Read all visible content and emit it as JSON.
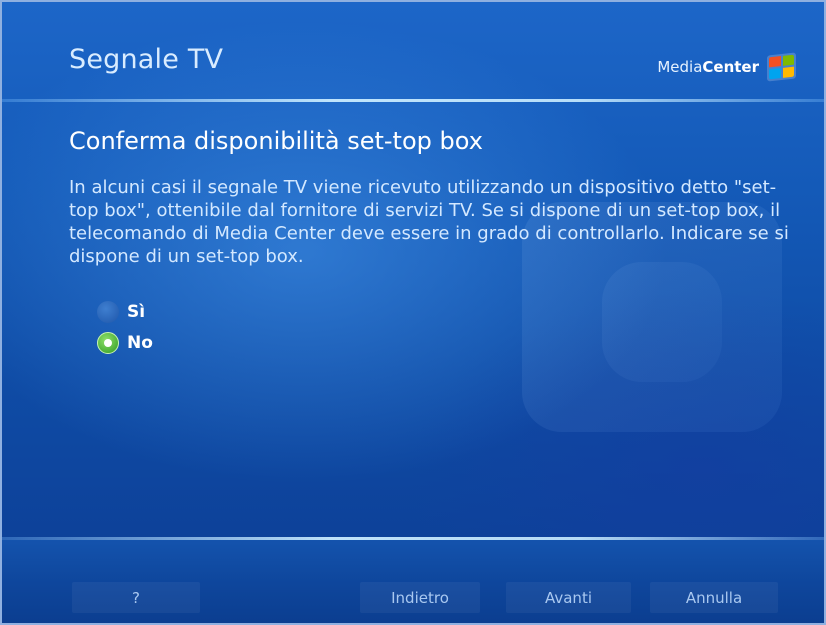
{
  "header": {
    "title": "Segnale TV"
  },
  "logo": {
    "prefix": "Media",
    "suffix": "Center",
    "icon": "windows-flag-icon"
  },
  "main": {
    "section_title": "Conferma disponibilità set-top box",
    "description": "In alcuni casi il segnale TV viene ricevuto utilizzando un dispositivo detto \"set-top box\", ottenibile dal fornitore di servizi TV. Se si dispone di un set-top box, il telecomando di Media Center deve essere in grado di controllarlo. Indicare se si dispone di un set-top box.",
    "options": [
      {
        "label": "Sì",
        "selected": false
      },
      {
        "label": "No",
        "selected": true
      }
    ]
  },
  "footer": {
    "help_label": "?",
    "back_label": "Indietro",
    "next_label": "Avanti",
    "cancel_label": "Annulla"
  },
  "colors": {
    "accent_green": "#2f9a22",
    "background_blue": "#145ab8"
  }
}
